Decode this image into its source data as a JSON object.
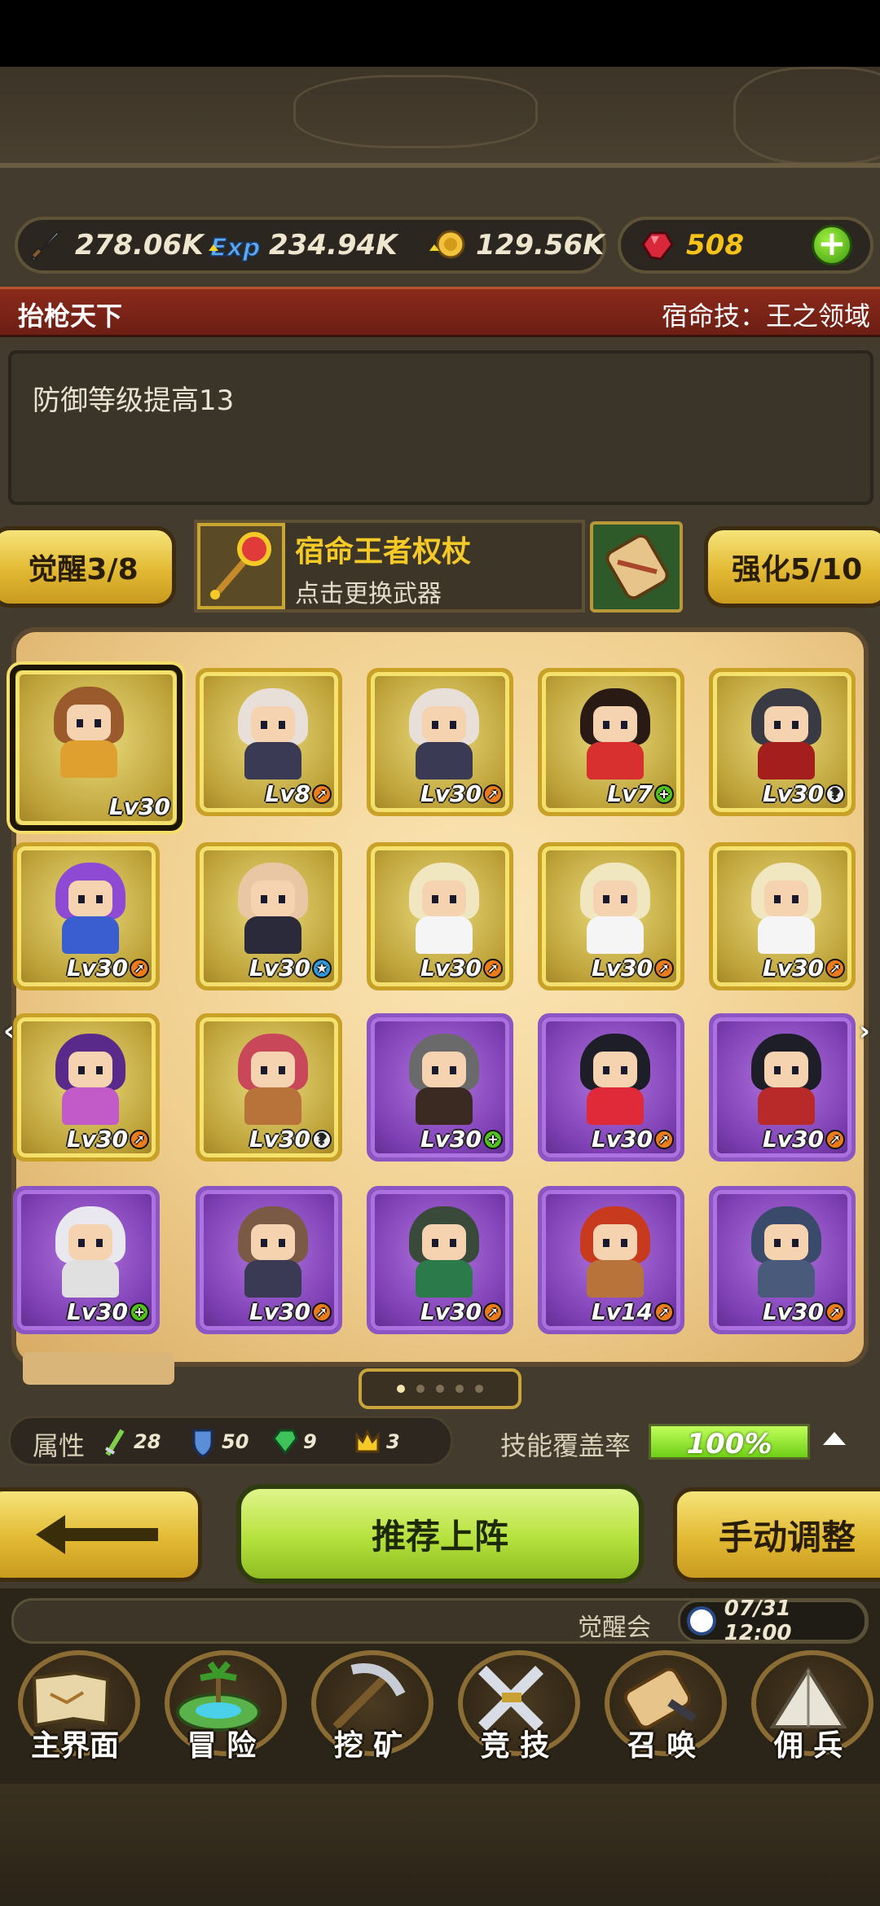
{
  "resources": {
    "swords": "278.06K",
    "exp": "234.94K",
    "coins": "129.56K",
    "gems": "508"
  },
  "banner": {
    "left": "抬枪天下",
    "right": "宿命技：王之领域"
  },
  "description": "防御等级提高13",
  "awaken_button": "觉醒3/8",
  "weapon": {
    "name": "宿命王者权杖",
    "subtitle": "点击更换武器"
  },
  "enhance_button": "强化5/10",
  "heroes": [
    {
      "level": "Lv30",
      "rarity": "gold",
      "badge": "",
      "selected": true,
      "hair": "#9a5a2b",
      "outfit": "#e0a030"
    },
    {
      "level": "Lv8",
      "rarity": "gold",
      "badge": "up",
      "selected": false,
      "hair": "#e8e0d8",
      "outfit": "#3a3a55"
    },
    {
      "level": "Lv30",
      "rarity": "gold",
      "badge": "up",
      "selected": false,
      "hair": "#e8e0d8",
      "outfit": "#3a3a55"
    },
    {
      "level": "Lv7",
      "rarity": "gold",
      "badge": "plus",
      "selected": false,
      "hair": "#2a1a14",
      "outfit": "#d82f2f"
    },
    {
      "level": "Lv30",
      "rarity": "gold",
      "badge": "question",
      "selected": false,
      "hair": "#3a3a44",
      "outfit": "#a51e1e"
    },
    {
      "level": "Lv30",
      "rarity": "gold",
      "badge": "up",
      "selected": false,
      "hair": "#8e4ad2",
      "outfit": "#3a5ed0"
    },
    {
      "level": "Lv30",
      "rarity": "gold",
      "badge": "star",
      "selected": false,
      "hair": "#e9c6a4",
      "outfit": "#2a2a3a"
    },
    {
      "level": "Lv30",
      "rarity": "gold",
      "badge": "up",
      "selected": false,
      "hair": "#f0e6c0",
      "outfit": "#f5f5f5"
    },
    {
      "level": "Lv30",
      "rarity": "gold",
      "badge": "up",
      "selected": false,
      "hair": "#f0e6c0",
      "outfit": "#f5f5f5"
    },
    {
      "level": "Lv30",
      "rarity": "gold",
      "badge": "up",
      "selected": false,
      "hair": "#f0e6c0",
      "outfit": "#f5f5f5"
    },
    {
      "level": "Lv30",
      "rarity": "gold",
      "badge": "up",
      "selected": false,
      "hair": "#5a2a8a",
      "outfit": "#c25ac8"
    },
    {
      "level": "Lv30",
      "rarity": "gold",
      "badge": "question",
      "selected": false,
      "hair": "#c8485a",
      "outfit": "#b8733a"
    },
    {
      "level": "Lv30",
      "rarity": "purple",
      "badge": "plus",
      "selected": false,
      "hair": "#6a6a6a",
      "outfit": "#3a2a22"
    },
    {
      "level": "Lv30",
      "rarity": "purple",
      "badge": "up",
      "selected": false,
      "hair": "#1e1e28",
      "outfit": "#e02a3a"
    },
    {
      "level": "Lv30",
      "rarity": "purple",
      "badge": "up",
      "selected": false,
      "hair": "#1e1e28",
      "outfit": "#b82a2a"
    },
    {
      "level": "Lv30",
      "rarity": "purple",
      "badge": "plus",
      "selected": false,
      "hair": "#e8e8ee",
      "outfit": "#e0e0e0"
    },
    {
      "level": "Lv30",
      "rarity": "purple",
      "badge": "up",
      "selected": false,
      "hair": "#7a5a44",
      "outfit": "#3a3a55"
    },
    {
      "level": "Lv30",
      "rarity": "purple",
      "badge": "up",
      "selected": false,
      "hair": "#3a4a3a",
      "outfit": "#2a7a4a"
    },
    {
      "level": "Lv14",
      "rarity": "purple",
      "badge": "up",
      "selected": false,
      "hair": "#c83a1e",
      "outfit": "#b8733a"
    },
    {
      "level": "Lv30",
      "rarity": "purple",
      "badge": "up",
      "selected": false,
      "hair": "#3a4a6a",
      "outfit": "#4a5a7a"
    }
  ],
  "stats": {
    "label": "属性",
    "sword": "28",
    "shield": "50",
    "gem": "9",
    "crown": "3"
  },
  "coverage": {
    "label": "技能覆盖率",
    "value": "100%",
    "fraction": 1.0
  },
  "buttons": {
    "recommend": "推荐上阵",
    "manual": "手动调整"
  },
  "notice": {
    "text": "觉醒会",
    "time": "07/31 12:00"
  },
  "nav": [
    {
      "label": "主界面",
      "icon": "map-icon"
    },
    {
      "label": "冒 险",
      "icon": "island-icon"
    },
    {
      "label": "挖 矿",
      "icon": "pickaxe-icon"
    },
    {
      "label": "竞 技",
      "icon": "crossed-swords-icon"
    },
    {
      "label": "召 唤",
      "icon": "scroll-icon"
    },
    {
      "label": "佣 兵",
      "icon": "tent-icon"
    }
  ],
  "pagination": {
    "pages": 5,
    "current": 0
  },
  "colors": {
    "gold": "#f5c926",
    "banner": "#8a2a1c",
    "green": "#b6e23e"
  }
}
